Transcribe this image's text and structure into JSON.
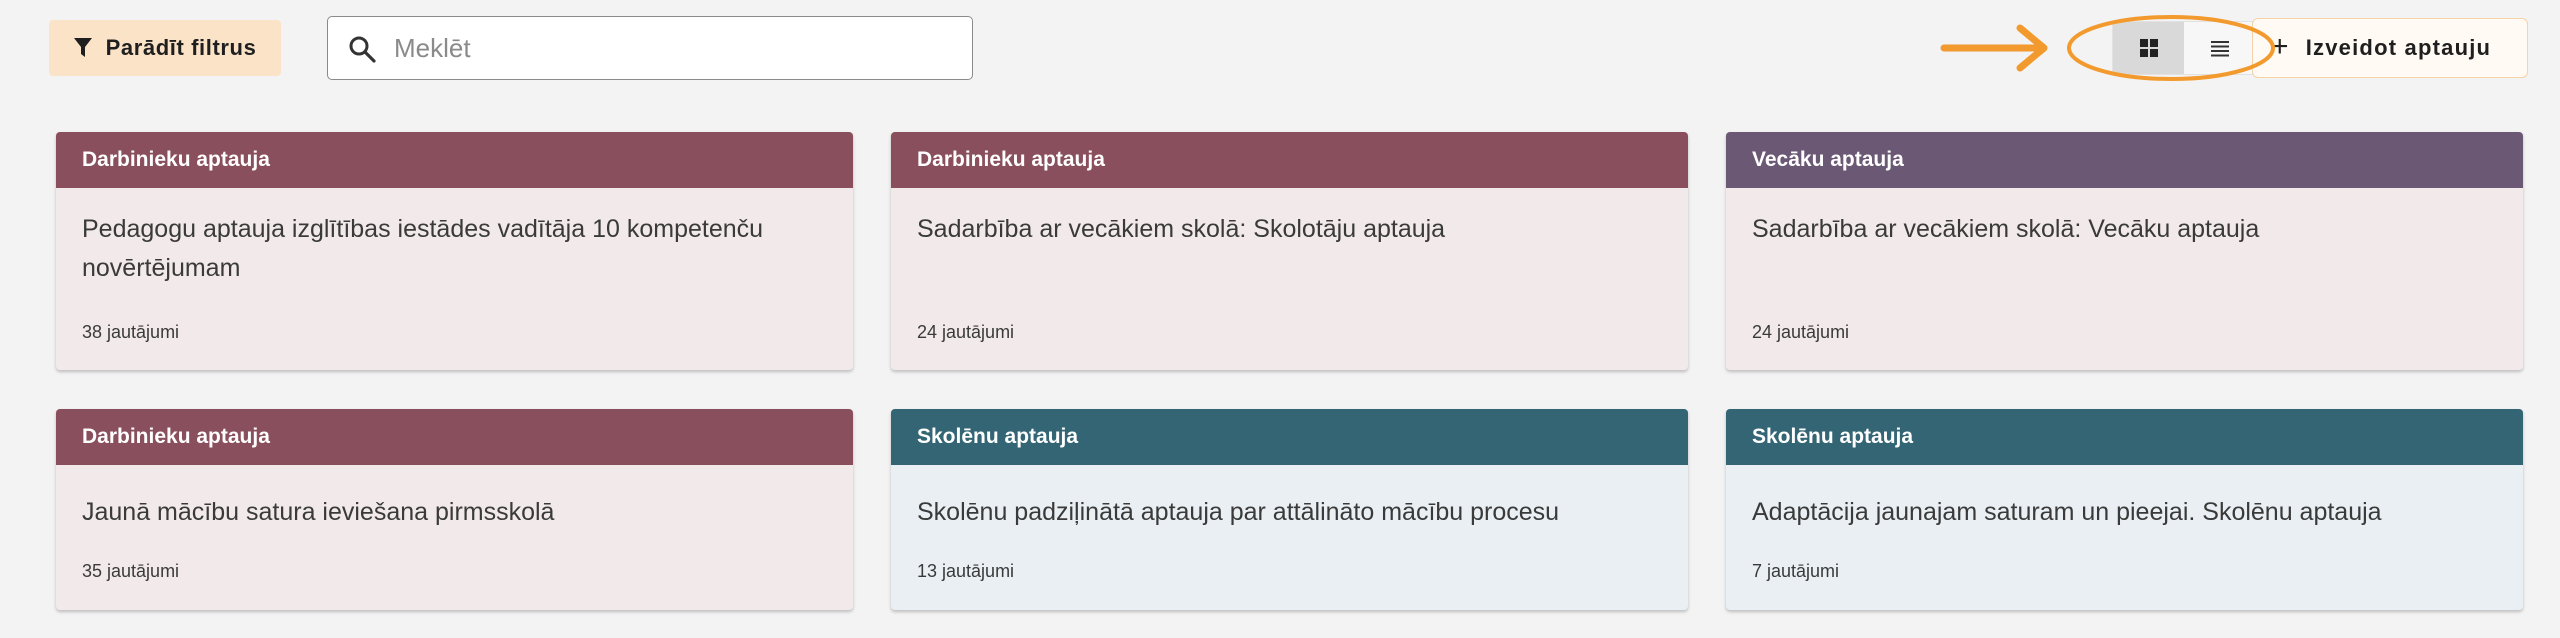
{
  "toolbar": {
    "filter_label": "Parādīt filtrus",
    "search_placeholder": "Meklēt",
    "search_value": "",
    "view_grid_icon": "grid-icon",
    "view_list_icon": "list-icon",
    "create_label": "Izveidot aptauju"
  },
  "colors": {
    "accent_orange": "#f39a2f",
    "header_employee": "#8a4f5c",
    "header_parent": "#6b5874",
    "header_student": "#336574",
    "body_warm": "#f2eaea",
    "body_cool": "#e9eff2"
  },
  "cards": [
    {
      "category": "Darbinieku aptauja",
      "title": "Pedagogu aptauja izglītības iestādes vadītāja 10 kompetenču novērtējumam",
      "count": "38 jautājumi"
    },
    {
      "category": "Darbinieku aptauja",
      "title": "Sadarbība ar vecākiem skolā: Skolotāju aptauja",
      "count": "24 jautājumi"
    },
    {
      "category": "Vecāku aptauja",
      "title": "Sadarbība ar vecākiem skolā: Vecāku aptauja",
      "count": "24 jautājumi"
    },
    {
      "category": "Darbinieku aptauja",
      "title": "Jaunā mācību satura ieviešana pirmsskolā",
      "count": "35 jautājumi"
    },
    {
      "category": "Skolēnu aptauja",
      "title": "Skolēnu padziļinātā aptauja par attālināto mācību procesu",
      "count": "13 jautājumi"
    },
    {
      "category": "Skolēnu aptauja",
      "title": "Adaptācija jaunajam saturam un pieejai. Skolēnu aptauja",
      "count": "7 jautājumi"
    }
  ]
}
